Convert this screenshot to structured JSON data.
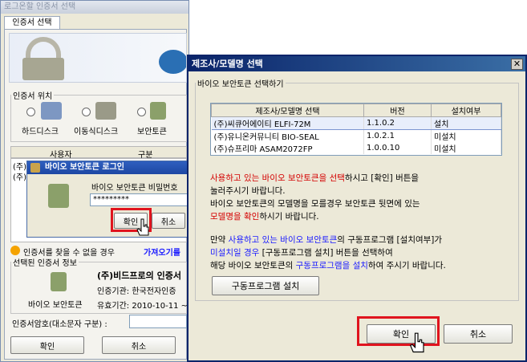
{
  "back_window": {
    "title": "로그온할 인증서 선택",
    "tab": "인증서 선택",
    "location_legend": "인증서 위치",
    "devices": [
      "하드디스크",
      "이동식디스크",
      "보안토큰"
    ],
    "list_columns": [
      "사용자",
      "구분"
    ],
    "list_rows": [
      "(주)",
      "(주)"
    ],
    "help_text": "인증서를 찾을 수 없을 경우",
    "import_link": "가져오기를",
    "selected_legend": "선택된 인증서 정보",
    "selected_name": "(주)비드프로의 인증서",
    "issuer": "인증기관: 한국전자인증",
    "device_label": "바이오 보안토큰",
    "validity": "유효기간: 2010-10-11 ~",
    "password_label": "인증서암호(대소문자 구분) :",
    "ok": "확인",
    "cancel": "취소"
  },
  "login_popup": {
    "title": "바이오 보안토큰 로그인",
    "password_label": "바이오 보안토큰 비밀번호",
    "password_value": "*********",
    "ok": "확인",
    "cancel": "취소"
  },
  "front_window": {
    "title": "제조사/모델명 선택",
    "group_legend": "바이오 보안토큰 선택하기",
    "columns": [
      "제조사/모델명 선택",
      "버전",
      "설치여부"
    ],
    "rows": [
      {
        "model": "(주)씨큐어에이티 ELFI-72M",
        "version": "1.1.0.2",
        "installed": "설치"
      },
      {
        "model": "(주)유니온커뮤니티 BIO-SEAL",
        "version": "1.0.2.1",
        "installed": "미설치"
      },
      {
        "model": "(주)슈프리마 ASAM2072FP",
        "version": "1.0.0.10",
        "installed": "미설치"
      }
    ],
    "para1": {
      "l1_red": "사용하고 있는 바이오 보안토큰을 선택",
      "l1_rest": "하시고 [확인] 버튼을",
      "l2": "눌러주시기 바랍니다.",
      "l3": "바이오 보안토큰의 모델명을 모를경우 보안토큰 뒷면에 있는",
      "l4_red": "모델명을 확인",
      "l4_rest": "하시기 바랍니다."
    },
    "para2": {
      "l1_a": "만약 ",
      "l1_blue": "사용하고 있는 바이오 보안토큰",
      "l1_b": "의 구동프로그램 [설치여부]가",
      "l2_blue": "미설치일 경우",
      "l2_b": " [구동프로그램 설치] 버튼을 선택하여",
      "l3_a": "해당 바이오 보안토큰의 ",
      "l3_blue": "구동프로그램을 설치",
      "l3_b": "하여 주시기 바랍니다."
    },
    "install_button": "구동프로그램 설치",
    "ok": "확인",
    "cancel": "취소"
  }
}
